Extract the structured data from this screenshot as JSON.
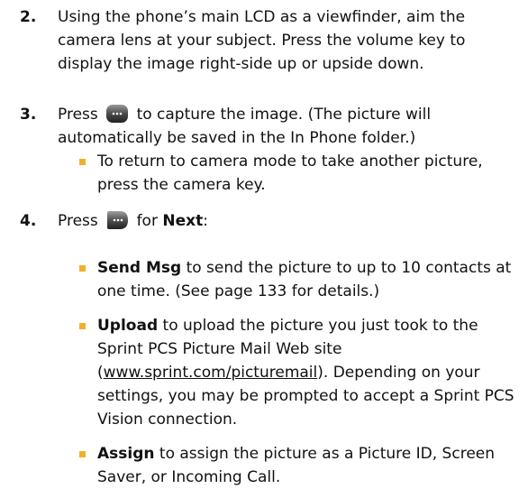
{
  "steps": [
    {
      "number": "2.",
      "text": "Using the phone’s main LCD as a viewfinder, aim the camera lens at your subject. Press the volume key to display the image right-side up or upside down."
    },
    {
      "number": "3.",
      "before_icon": "Press",
      "icon": "menu-ok-softkey-icon",
      "after_icon_line1": "to capture the image. (The picture will",
      "line2": "automatically be saved in the In Phone folder.)",
      "bullets": [
        {
          "text": "To return to camera mode to take another picture, press the camera key."
        }
      ]
    },
    {
      "number": "4.",
      "before_icon": "Press",
      "icon": "right-softkey-icon",
      "after_icon": "for",
      "bold": "Next",
      "after_bold": ":",
      "bullets": [
        {
          "bold": "Send Msg",
          "text": "to send the picture to up to 10 contacts at one time. (See page 133 for details.)"
        },
        {
          "bold": "Upload",
          "text_before_link": "to upload the picture you just took to the Sprint PCS Picture Mail Web site (",
          "link_line1": "www.sprint.com/",
          "link_line2": "picturemail",
          "text_after_link": "). Depending on your settings, you may be prompted to accept a Sprint PCS Vision connection."
        },
        {
          "bold": "Assign",
          "text": "to assign the picture as a Picture ID, Screen Saver, or Incoming Call."
        }
      ]
    }
  ],
  "colors": {
    "bullet": "#f2b02a",
    "text": "#111111",
    "icon_dark": "#333333",
    "icon_light": "#bbbbbb"
  }
}
